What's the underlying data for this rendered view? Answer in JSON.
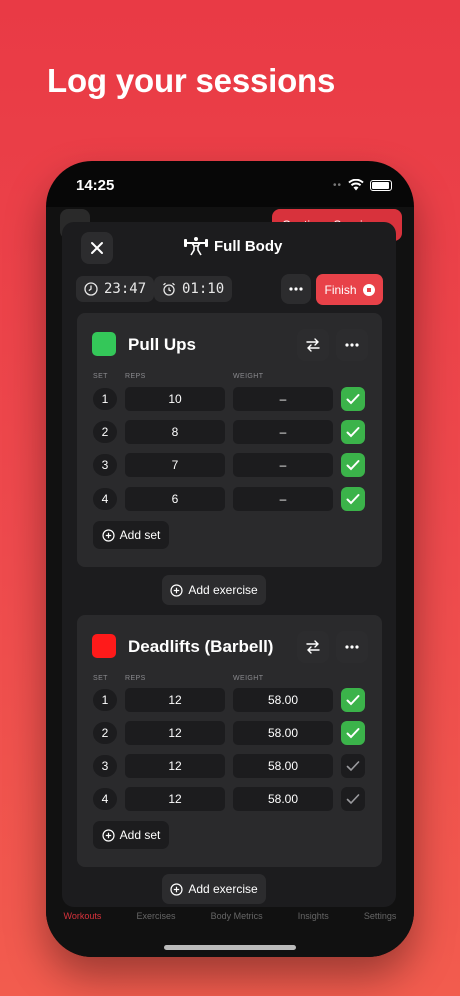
{
  "headline": "Log your sessions",
  "status_bar": {
    "time": "14:25"
  },
  "background": {
    "continue_label": "Continue Session",
    "tabs": [
      "Workouts",
      "Exercises",
      "Body Metrics",
      "Insights",
      "Settings"
    ],
    "active_tab": "Workouts",
    "accent": "#d8323c"
  },
  "header": {
    "title": "Full Body",
    "elapsed_timer": "23:47",
    "rest_timer": "01:10",
    "finish_label": "Finish",
    "icons": {
      "close": "close-icon",
      "workout": "weightlifter-icon",
      "elapsed": "clock-icon",
      "rest": "alarm-icon",
      "menu": "more-icon",
      "finish": "stop-icon"
    }
  },
  "columns": {
    "set": "SET",
    "reps": "REPS",
    "weight": "WEIGHT"
  },
  "exercises": [
    {
      "name": "Pull Ups",
      "color": "#34c759",
      "add_set_label": "Add set",
      "sets": [
        {
          "num": "1",
          "reps": "10",
          "weight": "–",
          "done": true
        },
        {
          "num": "2",
          "reps": "8",
          "weight": "–",
          "done": true
        },
        {
          "num": "3",
          "reps": "7",
          "weight": "–",
          "done": true
        },
        {
          "num": "4",
          "reps": "6",
          "weight": "–",
          "done": true
        }
      ]
    },
    {
      "name": "Deadlifts (Barbell)",
      "color": "#ff1a1a",
      "add_set_label": "Add set",
      "sets": [
        {
          "num": "1",
          "reps": "12",
          "weight": "58.00",
          "done": true
        },
        {
          "num": "2",
          "reps": "12",
          "weight": "58.00",
          "done": true
        },
        {
          "num": "3",
          "reps": "12",
          "weight": "58.00",
          "done": false
        },
        {
          "num": "4",
          "reps": "12",
          "weight": "58.00",
          "done": false
        }
      ]
    }
  ],
  "add_exercise_label": "Add exercise",
  "colors": {
    "done": "#3bb34a",
    "finish": "#e84249",
    "sheet": "#1c1c1e",
    "card": "#2a2a2c"
  }
}
